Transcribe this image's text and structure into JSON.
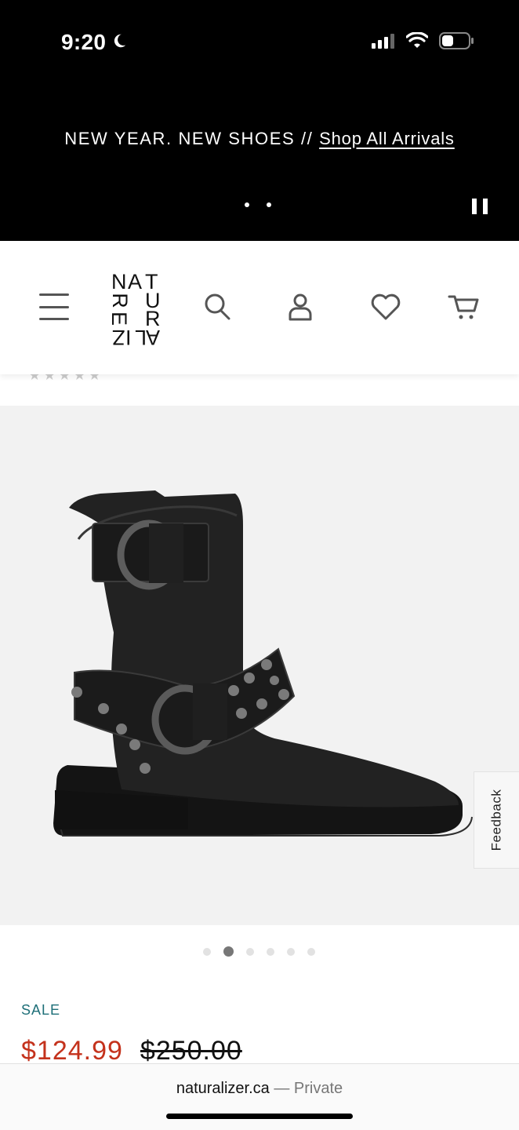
{
  "status_bar": {
    "time": "9:20"
  },
  "promo_banner": {
    "text": "NEW YEAR. NEW SHOES // ",
    "link": "Shop All Arrivals"
  },
  "header": {
    "logo": {
      "letters": [
        "N",
        "A",
        "T",
        "U",
        "R",
        "A",
        "L",
        "I",
        "Z",
        "E",
        "R"
      ]
    },
    "icons": [
      "menu-icon",
      "search-icon",
      "account-icon",
      "heart-icon",
      "cart-icon"
    ]
  },
  "product": {
    "image_alt": "Black leather moto boot with studded harness straps",
    "carousel": {
      "total": 6,
      "active_index": 1
    },
    "sale_label": "SALE",
    "price_sale": "$124.99",
    "price_original": "$250.00"
  },
  "feedback_tab": {
    "label": "Feedback"
  },
  "browser": {
    "domain": "naturalizer.ca",
    "separator": " — ",
    "mode": "Private"
  },
  "colors": {
    "sale_text": "#1e6f78",
    "sale_price": "#c4321c",
    "banner_bg": "#000000",
    "image_bg": "#f2f2f2"
  }
}
